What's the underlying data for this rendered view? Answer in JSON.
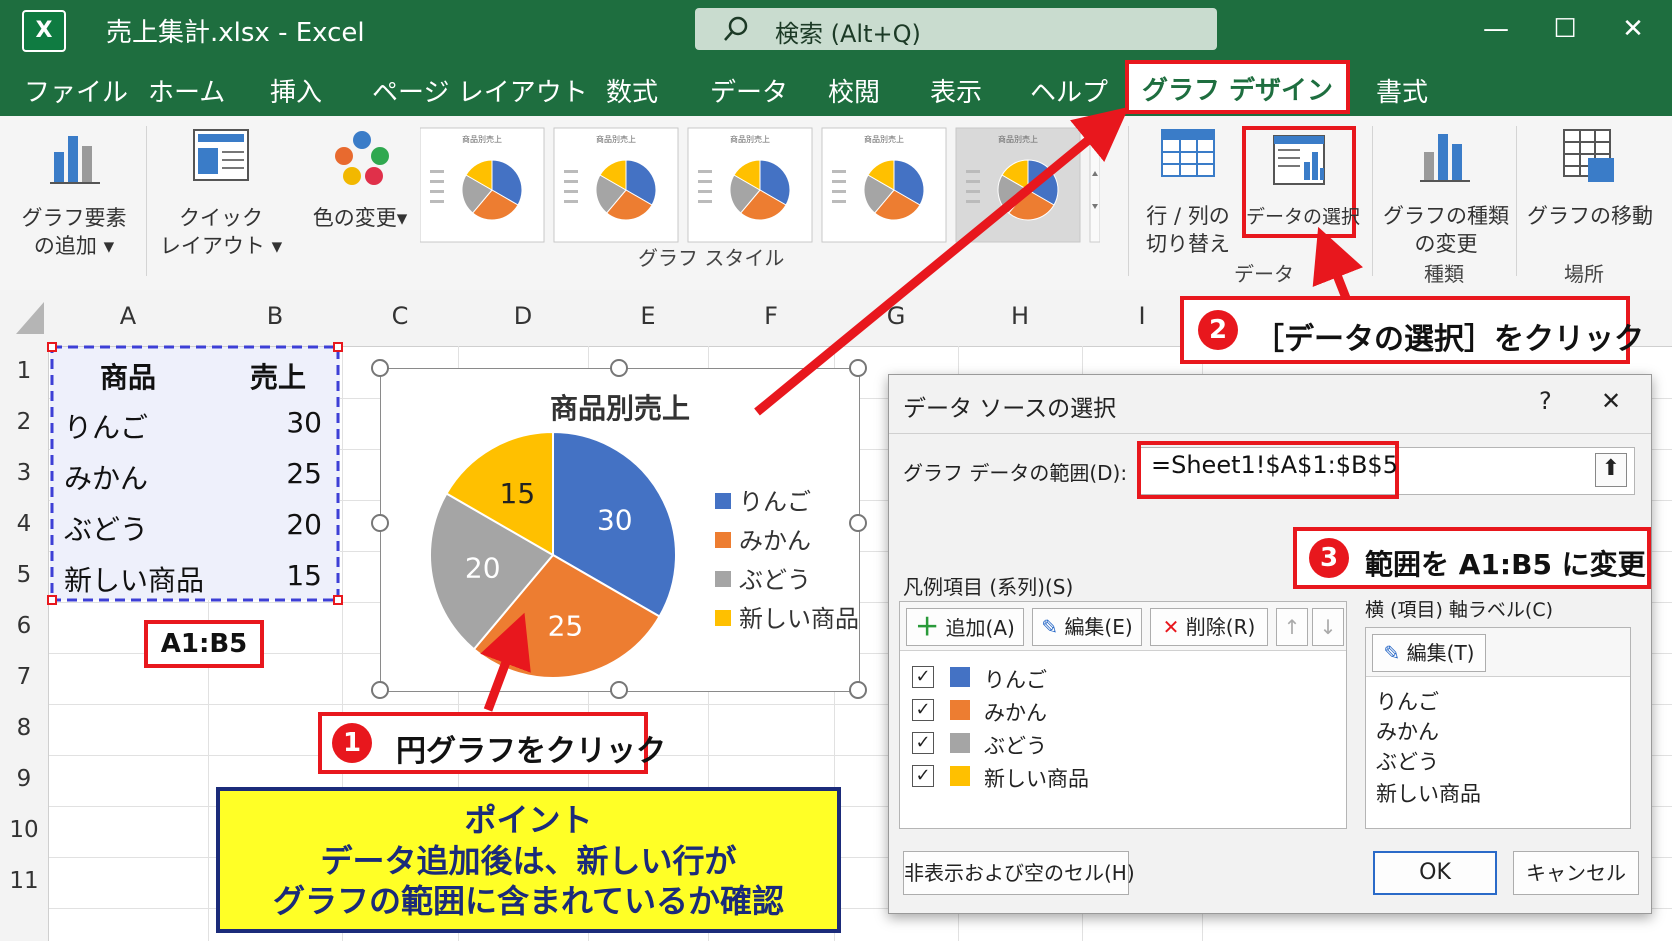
{
  "window": {
    "title": "売上集計.xlsx  -  Excel",
    "logo": "X",
    "search_placeholder": "検索 (Alt+Q)",
    "controls": {
      "minimize": "—",
      "maximize": "☐",
      "close": "✕"
    }
  },
  "menu": {
    "items": [
      "ファイル",
      "ホーム",
      "挿入",
      "ページ レイアウト",
      "数式",
      "データ",
      "校閲",
      "表示",
      "ヘルプ"
    ],
    "active": "グラフ デザイン",
    "after": "書式"
  },
  "ribbon": {
    "add_element": [
      "グラフ要素",
      "の追加 ▾"
    ],
    "quick_layout": [
      "クイック",
      "レイアウト ▾"
    ],
    "change_colors": "色の変更▾",
    "style_thumb_title": "商品別売上",
    "styles_group": "グラフ スタイル",
    "switch_row_col": [
      "行 / 列の",
      "切り替え"
    ],
    "select_data": "データの選択",
    "data_group": "データ",
    "change_type": [
      "グラフの種類",
      "の変更"
    ],
    "type_group": "種類",
    "move_chart": "グラフの移動",
    "location_group": "場所"
  },
  "sheet": {
    "columns": [
      "A",
      "B",
      "C",
      "D",
      "E",
      "F",
      "G",
      "H",
      "I"
    ],
    "rows": [
      "1",
      "2",
      "3",
      "4",
      "5",
      "6",
      "7",
      "8",
      "9",
      "10",
      "11"
    ],
    "header": {
      "a": "商品",
      "b": "売上"
    },
    "data": [
      {
        "name": "りんご",
        "value": "30"
      },
      {
        "name": "みかん",
        "value": "25"
      },
      {
        "name": "ぶどう",
        "value": "20"
      },
      {
        "name": "新しい商品",
        "value": "15"
      }
    ],
    "range_label": "A1:B5"
  },
  "chart_data": {
    "type": "pie",
    "title": "商品別売上",
    "categories": [
      "りんご",
      "みかん",
      "ぶどう",
      "新しい商品"
    ],
    "values": [
      30,
      25,
      20,
      15
    ],
    "colors": [
      "#4472c4",
      "#ed7d31",
      "#a5a5a5",
      "#ffc000"
    ],
    "legend": "right",
    "data_labels": true
  },
  "callouts": {
    "step1": {
      "num": "1",
      "text": "円グラフをクリック"
    },
    "step2": {
      "num": "2",
      "text": "［データの選択］をクリック"
    },
    "step3": {
      "num": "3",
      "text": "範囲を A1:B5 に変更"
    }
  },
  "point": {
    "title": "ポイント",
    "line1": "データ追加後は、新しい行が",
    "line2": "グラフの範囲に含まれているか確認"
  },
  "dialog": {
    "title": "データ ソースの選択",
    "help": "?",
    "close": "✕",
    "range_label": "グラフ データの範囲(D):",
    "range_value": "=Sheet1!$A$1:$B$5",
    "series_label": "凡例項目 (系列)(S)",
    "add": "追加(A)",
    "edit": "編集(E)",
    "delete": "削除(R)",
    "axis_label": "横 (項目) 軸ラベル(C)",
    "axis_edit": "編集(T)",
    "series": [
      "りんご",
      "みかん",
      "ぶどう",
      "新しい商品"
    ],
    "axis_items": [
      "りんご",
      "みかん",
      "ぶどう",
      "新しい商品"
    ],
    "hidden_cells": "非表示および空のセル(H)",
    "ok": "OK",
    "cancel": "キャンセル"
  }
}
